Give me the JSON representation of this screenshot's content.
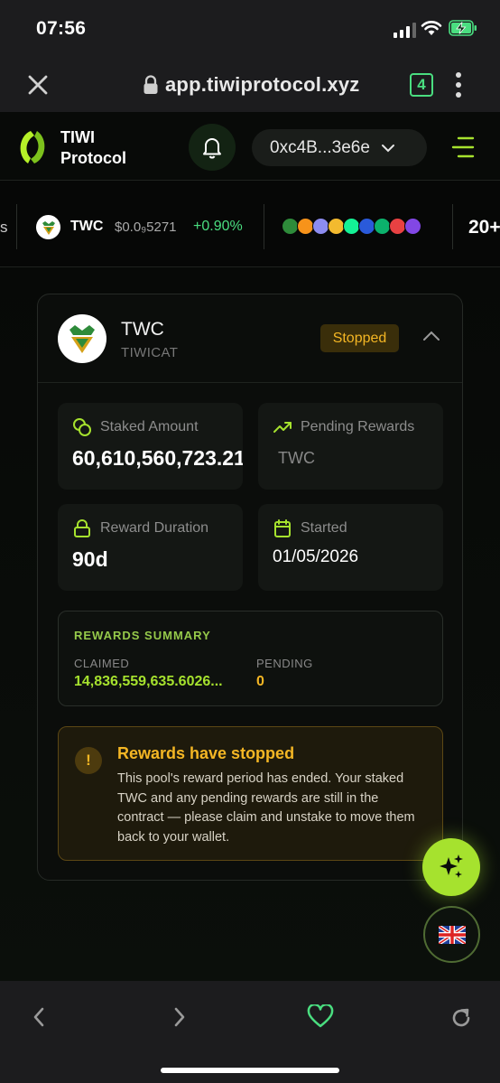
{
  "status_bar": {
    "time": "07:56"
  },
  "browser": {
    "url": "app.tiwiprotocol.xyz",
    "tab_count": "4"
  },
  "header": {
    "brand_line1": "TIWI",
    "brand_line2": "Protocol",
    "wallet_address": "0xc4B...3e6e",
    "accent_color": "#a6e22e"
  },
  "ticker": {
    "prev_fragment": "s",
    "symbol": "TWC",
    "price": "$0.0₉5271",
    "change": "+0.90%",
    "more_count": "20+"
  },
  "pool": {
    "symbol": "TWC",
    "name": "TIWICAT",
    "status": "Stopped",
    "stats": {
      "staked_label": "Staked Amount",
      "staked_value": "60,610,560,723.21",
      "pending_label": "Pending Rewards",
      "pending_value": "TWC",
      "duration_label": "Reward Duration",
      "duration_value": "90d",
      "started_label": "Started",
      "started_value": "01/05/2026"
    },
    "summary": {
      "title": "REWARDS SUMMARY",
      "claimed_label": "CLAIMED",
      "claimed_value": "14,836,559,635.6026...",
      "pending_label": "PENDING",
      "pending_value": "0"
    },
    "alert": {
      "icon": "!",
      "title": "Rewards have stopped",
      "message": "This pool's reward period has ended. Your staked TWC and any pending rewards are still in the contract — please claim and unstake to move them back to your wallet."
    }
  }
}
